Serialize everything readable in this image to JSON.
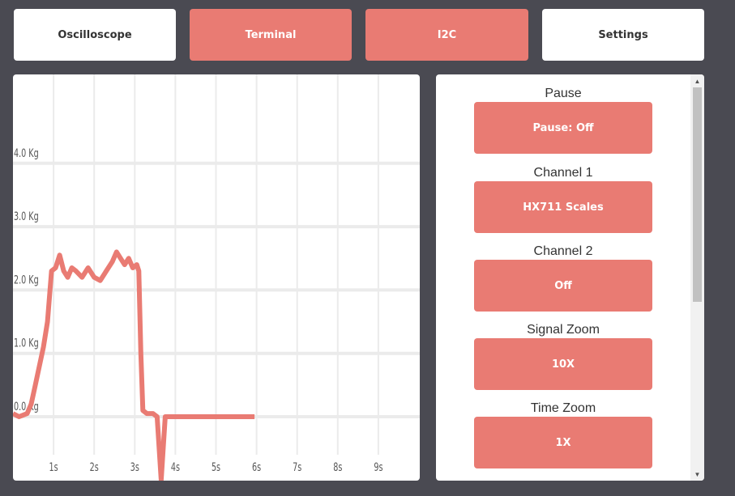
{
  "nav": {
    "tabs": [
      {
        "label": "Oscilloscope",
        "style": "white"
      },
      {
        "label": "Terminal",
        "style": "red"
      },
      {
        "label": "I2C",
        "style": "red"
      },
      {
        "label": "Settings",
        "style": "white"
      }
    ]
  },
  "controls": {
    "pause": {
      "label": "Pause",
      "button": "Pause: Off"
    },
    "channel1": {
      "label": "Channel 1",
      "button": "HX711 Scales"
    },
    "channel2": {
      "label": "Channel 2",
      "button": "Off"
    },
    "signal_zoom": {
      "label": "Signal Zoom",
      "button": "10X"
    },
    "time_zoom": {
      "label": "Time Zoom",
      "button": "1X"
    }
  },
  "colors": {
    "accent": "#e97b73",
    "background": "#4a4a52",
    "panel": "#ffffff",
    "grid": "#ebebeb"
  },
  "chart_data": {
    "type": "line",
    "x_ticks": [
      "1s",
      "2s",
      "3s",
      "4s",
      "5s",
      "6s",
      "7s",
      "8s",
      "9s"
    ],
    "y_ticks": [
      "0.0 Kg",
      "1.0 Kg",
      "2.0 Kg",
      "3.0 Kg",
      "4.0 Kg"
    ],
    "xlim": [
      0,
      10
    ],
    "ylim": [
      -1,
      5
    ],
    "grid": true,
    "series": [
      {
        "color": "#e97b73",
        "x": [
          0,
          0.15,
          0.35,
          0.45,
          0.55,
          0.65,
          0.75,
          0.85,
          0.95,
          1.05,
          1.15,
          1.25,
          1.35,
          1.45,
          1.55,
          1.7,
          1.85,
          2.0,
          2.15,
          2.3,
          2.45,
          2.55,
          2.65,
          2.75,
          2.85,
          2.95,
          3.05,
          3.1,
          3.15,
          3.2,
          3.3,
          3.45,
          3.55,
          3.6,
          3.65,
          3.7,
          3.75,
          3.8,
          3.9,
          4.2,
          4.6,
          5.0,
          5.5,
          5.95
        ],
        "y": [
          0.05,
          0.0,
          0.05,
          0.2,
          0.5,
          0.8,
          1.1,
          1.5,
          2.3,
          2.35,
          2.55,
          2.3,
          2.2,
          2.35,
          2.3,
          2.2,
          2.35,
          2.2,
          2.15,
          2.3,
          2.45,
          2.6,
          2.5,
          2.4,
          2.5,
          2.35,
          2.4,
          2.3,
          1.0,
          0.1,
          0.05,
          0.05,
          0.0,
          -0.5,
          -1.0,
          -0.5,
          0.0,
          0.0,
          0.0,
          0.0,
          0.0,
          0.0,
          0.0,
          0.0
        ]
      }
    ]
  }
}
